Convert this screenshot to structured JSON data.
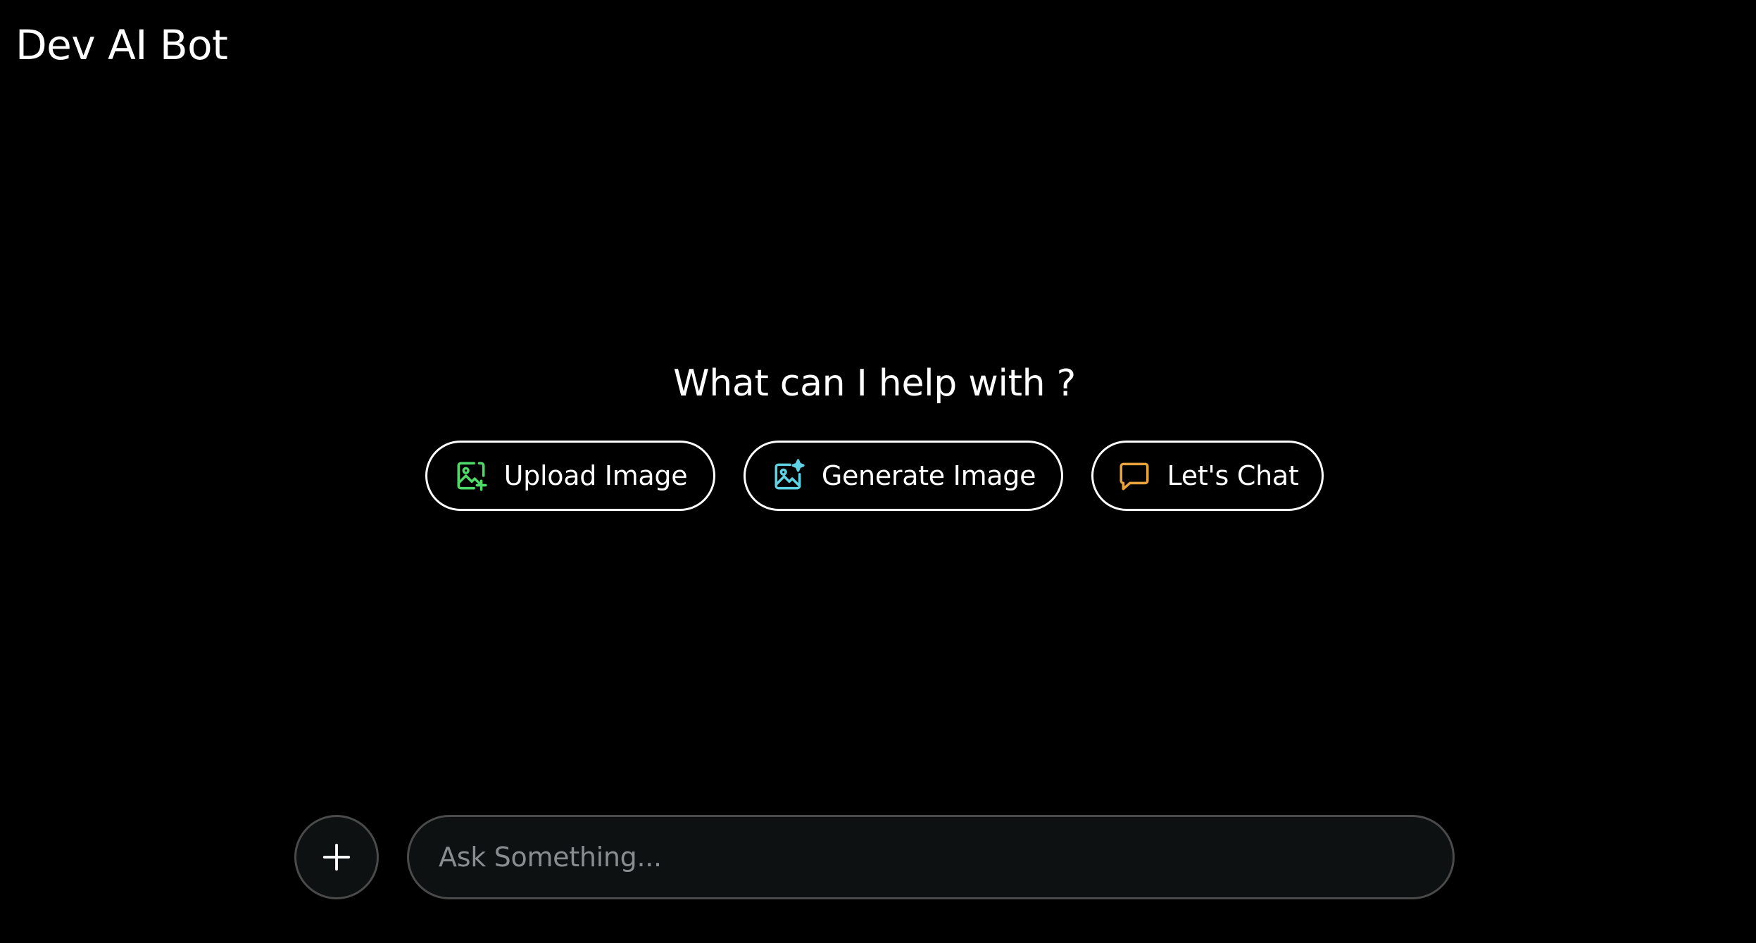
{
  "header": {
    "title": "Dev AI Bot"
  },
  "main": {
    "heading": "What can I help with ?",
    "actions": [
      {
        "label": "Upload Image",
        "icon": "image-plus-icon",
        "color": "#4fdb6a"
      },
      {
        "label": "Generate Image",
        "icon": "image-sparkle-icon",
        "color": "#5fd3e6"
      },
      {
        "label": "Let's Chat",
        "icon": "chat-bubble-icon",
        "color": "#e8a23c"
      }
    ]
  },
  "composer": {
    "add_icon": "plus-icon",
    "placeholder": "Ask Something...",
    "value": ""
  },
  "colors": {
    "background": "#000000",
    "input_background": "#0d1112",
    "input_border": "#4a4a4a",
    "placeholder": "#8a8d8f"
  }
}
